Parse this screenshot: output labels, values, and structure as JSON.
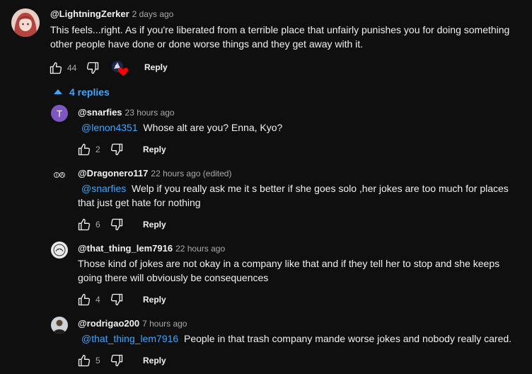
{
  "top_comment": {
    "handle": "@LightningZerker",
    "time": "2 days ago",
    "text": "This feels...right. As if you're liberated from a terrible place that unfairly punishes you for doing something other people have done or done worse things and they get away with it.",
    "likes": "44",
    "reply_label": "Reply"
  },
  "replies_toggle": "4 replies",
  "replies": [
    {
      "handle": "@snarfies",
      "time": "23 hours ago",
      "mention": "@lenon4351",
      "text": "Whose alt are you?  Enna, Kyo?",
      "likes": "2",
      "reply_label": "Reply",
      "avatar_letter": "T"
    },
    {
      "handle": "@Dragonero117",
      "time": "22 hours ago (edited)",
      "mention": "@snarfies",
      "text": "Welp if you really ask me it s better if she goes solo ,her jokes are too much for places that just get hate for nothing",
      "likes": "6",
      "reply_label": "Reply"
    },
    {
      "handle": "@that_thing_lem7916",
      "time": "22 hours ago",
      "text": "Those kind of jokes are not okay in a company like that and if they tell her to stop and she keeps going there will obviously be consequences",
      "likes": "4",
      "reply_label": "Reply"
    },
    {
      "handle": "@rodrigao200",
      "time": "7 hours ago",
      "mention": "@that_thing_lem7916",
      "text": "People in that trash company mande worse jokes and nobody really cared.",
      "likes": "5",
      "reply_label": "Reply"
    }
  ],
  "colors": {
    "background": "#0f0f0f",
    "link": "#3ea6ff",
    "secondary_text": "#aaaaaa",
    "avatar_purple": "#7e57c2",
    "heart": "#ff0000"
  }
}
